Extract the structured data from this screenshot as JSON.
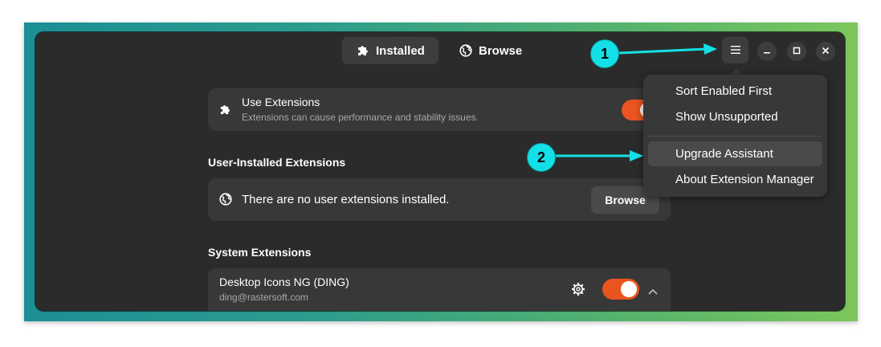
{
  "tabs": [
    {
      "label": "Installed",
      "icon": "puzzle-icon",
      "active": true
    },
    {
      "label": "Browse",
      "icon": "globe-icon",
      "active": false
    }
  ],
  "window_controls": {
    "menu": "hamburger-menu-icon",
    "minimize": "minimize-icon",
    "maximize": "maximize-icon",
    "close": "close-icon"
  },
  "use_extensions": {
    "title": "Use Extensions",
    "subtitle": "Extensions can cause performance and stability issues.",
    "enabled": true
  },
  "user_installed": {
    "heading": "User-Installed Extensions",
    "empty_text": "There are no user extensions installed.",
    "browse_label": "Browse"
  },
  "system_extensions": {
    "heading": "System Extensions",
    "items": [
      {
        "name": "Desktop Icons NG (DING)",
        "uuid": "ding@rastersoft.com",
        "enabled": true
      }
    ]
  },
  "menu": {
    "items": [
      {
        "label": "Sort Enabled First"
      },
      {
        "label": "Show Unsupported"
      },
      {
        "label": "Upgrade Assistant",
        "highlighted": true
      },
      {
        "label": "About Extension Manager"
      }
    ]
  },
  "annotations": [
    {
      "label": "1"
    },
    {
      "label": "2"
    }
  ],
  "colors": {
    "accent": "#e95420",
    "annotation": "#13e0e6",
    "window_bg": "#2b2b2b",
    "card_bg": "#383838"
  }
}
